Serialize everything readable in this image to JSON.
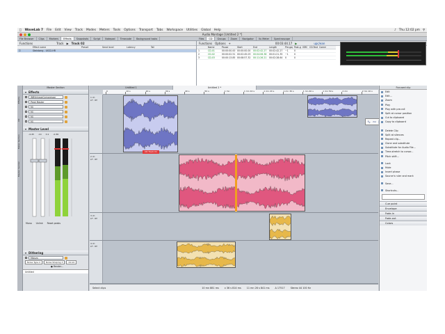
{
  "menubar": {
    "app": "WaveLab 7",
    "items": [
      "File",
      "Edit",
      "View",
      "Track",
      "Modes",
      "Meters",
      "Tools",
      "Options",
      "Transport",
      "Tabs",
      "Workspace",
      "Utilities",
      "Global",
      "Help"
    ],
    "clock": "Thu 12:02 pm"
  },
  "window": {
    "title": "Audio Montage [Untitled 2 *]"
  },
  "left_tabs": [
    "File Browser",
    "Clips",
    "Markers",
    "Effects",
    "Snapshots",
    "Script",
    "Notepad",
    "Timecode",
    "Background tasks"
  ],
  "right_tabs": [
    "Files",
    "CD",
    "Groups",
    "Zoom",
    "Navigator",
    "Vu Meter",
    "Spectroscope"
  ],
  "effects_panel": {
    "functions_label": "Functions",
    "track_label": "Track",
    "track_name": "Track 02",
    "columns": [
      "Effect name",
      "Preset",
      "Send level",
      "Latency",
      "Tail"
    ],
    "rows": [
      {
        "name": "Steinberg - UV22-HR"
      }
    ]
  },
  "cd_panel": {
    "functions_label": "Functions",
    "options_label": "Options",
    "time": "00:03:44.17",
    "isrc": "upc/ean",
    "columns": [
      "Name",
      "Pause",
      "Start",
      "End",
      "Length",
      "Pre-gap",
      "Post-gap",
      "ISRC",
      "CD-Text",
      "Comment"
    ],
    "rows": [
      {
        "num": "1",
        "name": "CD-01",
        "pause": "00:00:00.00",
        "start": "00:00:00.00",
        "end": "00:02:42.27",
        "length": "00:02:42.27",
        "pregap": "~1",
        "postgap": "0"
      },
      {
        "num": "2",
        "name": "CD-02",
        "pause": "00:00:02.51",
        "start": "00:02:45.03",
        "end": "00:04:06.38",
        "length": "00:01:21.35",
        "pregap": "~1",
        "postgap": "0"
      },
      {
        "num": "3",
        "name": "CD-03",
        "pause": "00:00:13.85",
        "start": "00:08:57.32",
        "end": "00:11:26.21",
        "length": "00:02:28.64",
        "pregap": "0",
        "postgap": "0"
      }
    ]
  },
  "sidebar_tabs": [
    "Effects",
    "CD",
    "Meter Section",
    "Master Section"
  ],
  "master": {
    "title": "Master Section",
    "effects_header": "Effects",
    "slots": [
      "WBVintageCompressor",
      "Peak Master",
      "Ml",
      "Ml",
      "Ml",
      "Ml"
    ],
    "master_level": "Master Level",
    "scale_top": [
      "-4.45",
      "-14",
      "0.1",
      "-0.36"
    ],
    "buttons": [
      "Mono",
      "Unlink",
      "Reset peaks"
    ],
    "dithering_header": "Dithering",
    "dithering_plugin": "Mbium",
    "noise_type": "Noise Type 2",
    "noise_shaping": "Noise Shaping 3",
    "bits": "24 bit",
    "render": "Render...",
    "preset": "Untitled"
  },
  "montage": {
    "tabs": [
      "Untitled 1",
      "Untitled 2 *"
    ],
    "ruler": [
      "0",
      "10 s",
      "20 s",
      "30 s",
      "40 s",
      "50 s",
      "1 mn",
      "1 mn 10 s",
      "1 mn 20 s",
      "1 mn 30 s",
      "1 mn 40 s",
      "1 mn 50 s",
      "2 mn",
      "2 mn 10 s"
    ],
    "tracks": [
      {
        "label": "1 ch",
        "sub": "LF : RT"
      },
      {
        "label": "2 ch",
        "sub": "LF : RT"
      },
      {
        "label": "3 ch",
        "sub": "LF : RT"
      },
      {
        "label": "4 ch",
        "sub": "LF : RT"
      }
    ],
    "clip_label": "CD Track 01"
  },
  "clip_menu": {
    "title": "Focused clip",
    "items": [
      "Edit",
      "Edit...",
      "Zoom",
      "Play",
      "Play with pre-roll",
      "Split at cursor position",
      "Cut to clipboard",
      "Copy to clipboard",
      "Delete Clip",
      "Split at silences",
      "Repeat clip...",
      "Clone and substitute",
      "Substitute for Audio File...",
      "Time-stretch to cursor...",
      "Pitch shift...",
      "Lock",
      "Mute",
      "Invert phase",
      "Source's ruler and mark",
      "Save...",
      "Shortcuts..."
    ],
    "sections": [
      "Cue point",
      "Envelope",
      "Fade-in",
      "Fade-out",
      "Colors"
    ]
  },
  "status": {
    "left": "Select clips",
    "pos1": "10 mn 881 ms",
    "pos2": "x 36 s 814 ms",
    "pos3": "11 mn 26 s 841 ms",
    "pos4": "Δ 17517",
    "format": "Stereo 44 100 Hz"
  },
  "colors": {
    "blue_clip": "#8a90cf",
    "pink_clip": "#e0577f",
    "yellow_clip": "#e7b84a",
    "accent": "#3a6ea5"
  }
}
